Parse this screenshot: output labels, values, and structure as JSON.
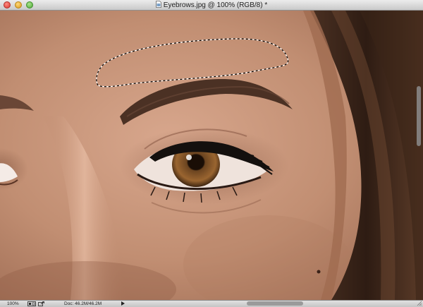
{
  "window": {
    "title": "Eyebrows.jpg @ 100% (RGB/8) *"
  },
  "canvas": {
    "image_description_icon": "photo-canvas",
    "selection_tool": "lasso-selection-icon"
  },
  "statusbar": {
    "zoom": "100%",
    "doc_size": "Doc: 46.2M/46.2M"
  },
  "colors": {
    "skin": "#c69478",
    "hair": "#3a2419",
    "iris": "#8a5a2a"
  }
}
